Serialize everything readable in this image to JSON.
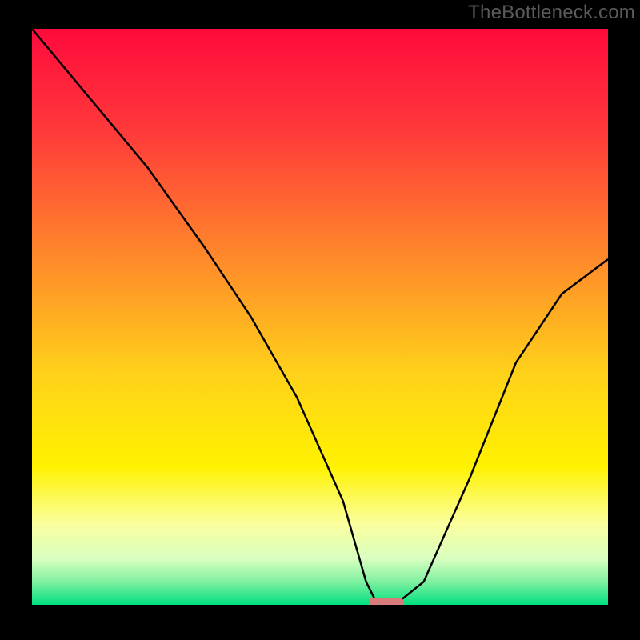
{
  "watermark": "TheBottleneck.com",
  "chart_data": {
    "type": "line",
    "title": "",
    "xlabel": "",
    "ylabel": "",
    "xlim": [
      0,
      100
    ],
    "ylim": [
      0,
      100
    ],
    "grid": false,
    "background": {
      "type": "vertical-gradient",
      "stops": [
        {
          "pos": 0,
          "color": "#ff0a3c"
        },
        {
          "pos": 18,
          "color": "#ff3a3a"
        },
        {
          "pos": 40,
          "color": "#ff8a2a"
        },
        {
          "pos": 60,
          "color": "#ffd21a"
        },
        {
          "pos": 76,
          "color": "#fff200"
        },
        {
          "pos": 86,
          "color": "#fbffa0"
        },
        {
          "pos": 92,
          "color": "#d8ffc0"
        },
        {
          "pos": 96,
          "color": "#80f0a0"
        },
        {
          "pos": 100,
          "color": "#00e080"
        }
      ]
    },
    "series": [
      {
        "name": "bottleneck-curve",
        "color": "#000000",
        "x": [
          0,
          10,
          20,
          30,
          38,
          46,
          54,
          58,
          60,
          63,
          68,
          76,
          84,
          92,
          100
        ],
        "y": [
          100,
          88,
          76,
          62,
          50,
          36,
          18,
          4,
          0,
          0,
          4,
          22,
          42,
          54,
          60
        ]
      }
    ],
    "marker": {
      "name": "optimal-point",
      "x_center": 61.5,
      "y": 0,
      "width": 6,
      "color": "#d97b7b"
    }
  }
}
